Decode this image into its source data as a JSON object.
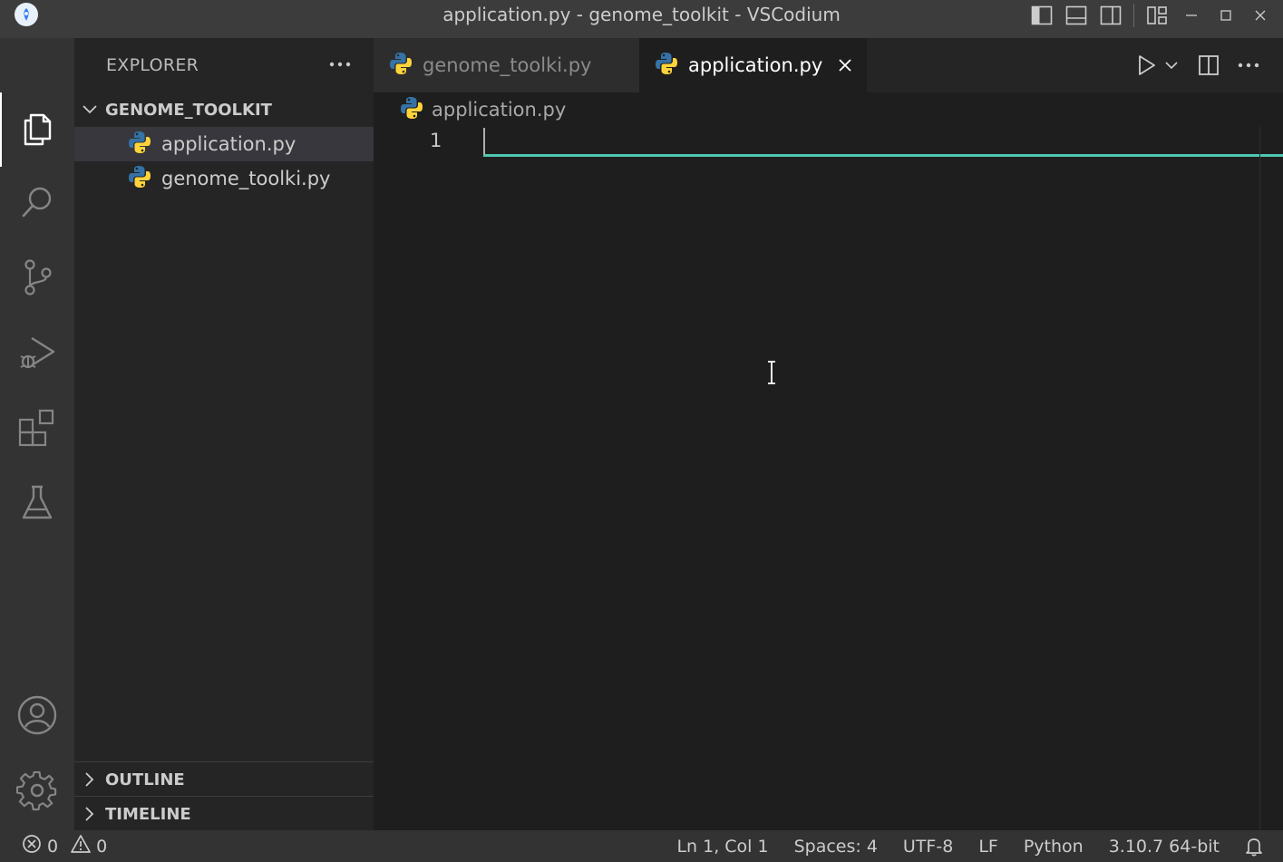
{
  "window": {
    "title": "application.py - genome_toolkit - VSCodium"
  },
  "activity_bar": {
    "items": [
      "files-icon",
      "search-icon",
      "source-control-icon",
      "run-debug-icon",
      "extensions-icon",
      "testing-icon"
    ],
    "bottom": [
      "account-icon",
      "settings-gear-icon"
    ]
  },
  "sidebar": {
    "title": "EXPLORER",
    "folder": "GENOME_TOOLKIT",
    "files": [
      {
        "name": "application.py",
        "selected": true
      },
      {
        "name": "genome_toolki.py",
        "selected": false
      }
    ],
    "outline_label": "OUTLINE",
    "timeline_label": "TIMELINE"
  },
  "tabs": [
    {
      "label": "genome_toolki.py",
      "active": false
    },
    {
      "label": "application.py",
      "active": true
    }
  ],
  "breadcrumb": {
    "file": "application.py"
  },
  "editor": {
    "line_numbers": [
      "1"
    ]
  },
  "status": {
    "errors": "0",
    "warnings": "0",
    "position": "Ln 1, Col 1",
    "spaces": "Spaces: 4",
    "encoding": "UTF-8",
    "eol": "LF",
    "language": "Python",
    "interpreter": "3.10.7 64-bit"
  },
  "colors": {
    "accent_line": "#4ec9b0",
    "python_blue": "#3572a5",
    "python_yellow": "#ffd43b"
  }
}
